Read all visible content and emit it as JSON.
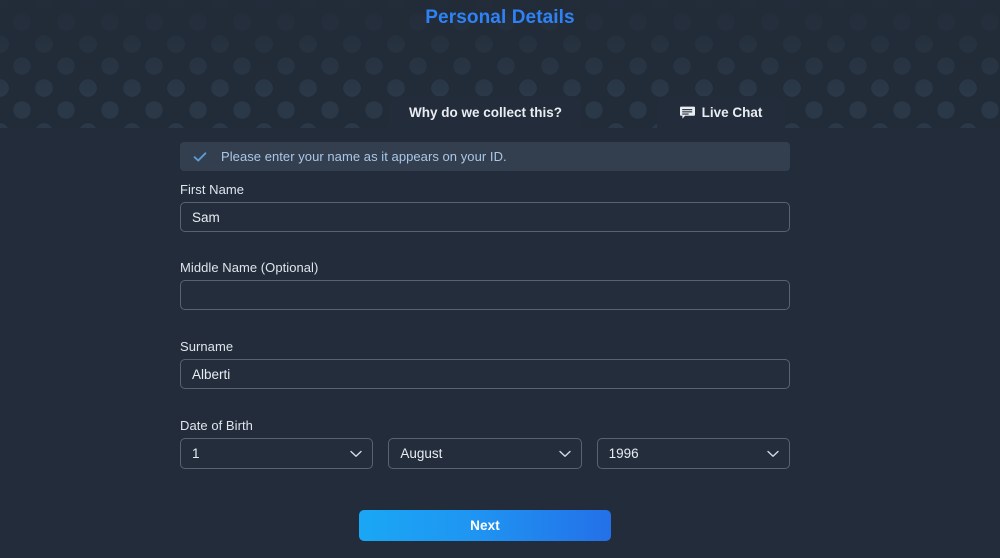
{
  "header": {
    "title": "Personal Details",
    "title_color": "#2f82f5",
    "background_color": "#222b38",
    "pattern_color": "#2b3948"
  },
  "tabs": [
    {
      "id": "why-collect",
      "label": "Why do we collect this?",
      "icon": null
    },
    {
      "id": "live-chat",
      "label": "Live Chat",
      "icon": "chat-bubble-icon"
    }
  ],
  "banner": {
    "icon": "check-icon",
    "icon_color": "#5b9bd5",
    "message": "Please enter your name as it appears on your ID.",
    "background_color": "#333f4e"
  },
  "fields": {
    "first_name": {
      "label": "First Name",
      "value": "Sam",
      "placeholder": ""
    },
    "middle_name": {
      "label": "Middle Name (Optional)",
      "value": "",
      "placeholder": ""
    },
    "surname": {
      "label": "Surname",
      "value": "Alberti",
      "placeholder": ""
    },
    "date_of_birth": {
      "label": "Date of Birth",
      "day": {
        "value": "1",
        "icon": "chevron-down-icon"
      },
      "month": {
        "value": "August",
        "icon": "chevron-down-icon"
      },
      "year": {
        "value": "1996",
        "icon": "chevron-down-icon"
      }
    }
  },
  "actions": {
    "next_label": "Next",
    "next_gradient_from": "#1aa7f5",
    "next_gradient_to": "#2470e8"
  },
  "theme": {
    "page_background": "#222c3a",
    "input_border": "#57646f",
    "text_primary": "#e6eaf0"
  }
}
